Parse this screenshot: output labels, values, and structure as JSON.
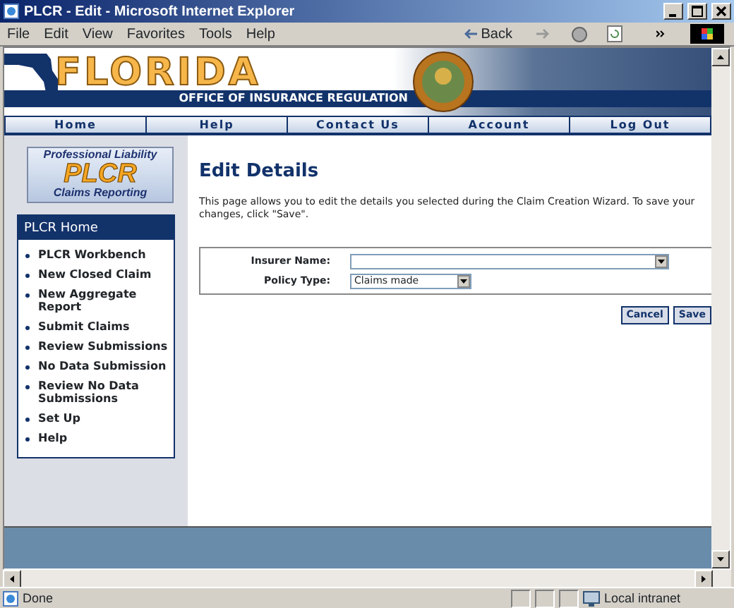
{
  "window": {
    "title": "PLCR - Edit - Microsoft Internet Explorer",
    "menu": [
      "File",
      "Edit",
      "View",
      "Favorites",
      "Tools",
      "Help"
    ],
    "back_label": "Back"
  },
  "header": {
    "state_name": "FLORIDA",
    "agency": "OFFICE OF INSURANCE REGULATION"
  },
  "nav": [
    "Home",
    "Help",
    "Contact Us",
    "Account",
    "Log Out"
  ],
  "sidebar": {
    "logo_top": "Professional Liability",
    "logo_main": "PLCR",
    "logo_bottom": "Claims Reporting",
    "panel_title": "PLCR Home",
    "links": [
      {
        "label": "PLCR Workbench"
      },
      {
        "label": "New Closed Claim"
      },
      {
        "label": "New Aggregate Report"
      },
      {
        "label": "Submit Claims"
      },
      {
        "label": "Review Submissions"
      },
      {
        "label": "No Data Submission"
      },
      {
        "label": "Review No Data Submissions"
      },
      {
        "label": "Set Up"
      },
      {
        "label": "Help"
      }
    ]
  },
  "main": {
    "heading": "Edit Details",
    "description": "This page allows you to edit the details you selected during the Claim Creation Wizard. To save your changes, click \"Save\".",
    "fields": [
      {
        "label": "Insurer Name:",
        "kind": "wide"
      },
      {
        "label": "Policy Type:",
        "kind": "narrow",
        "value": "Claims made"
      }
    ],
    "buttons": [
      "Cancel",
      "Save"
    ]
  },
  "status_bar": {
    "text": "Done",
    "zone": "Local intranet"
  }
}
